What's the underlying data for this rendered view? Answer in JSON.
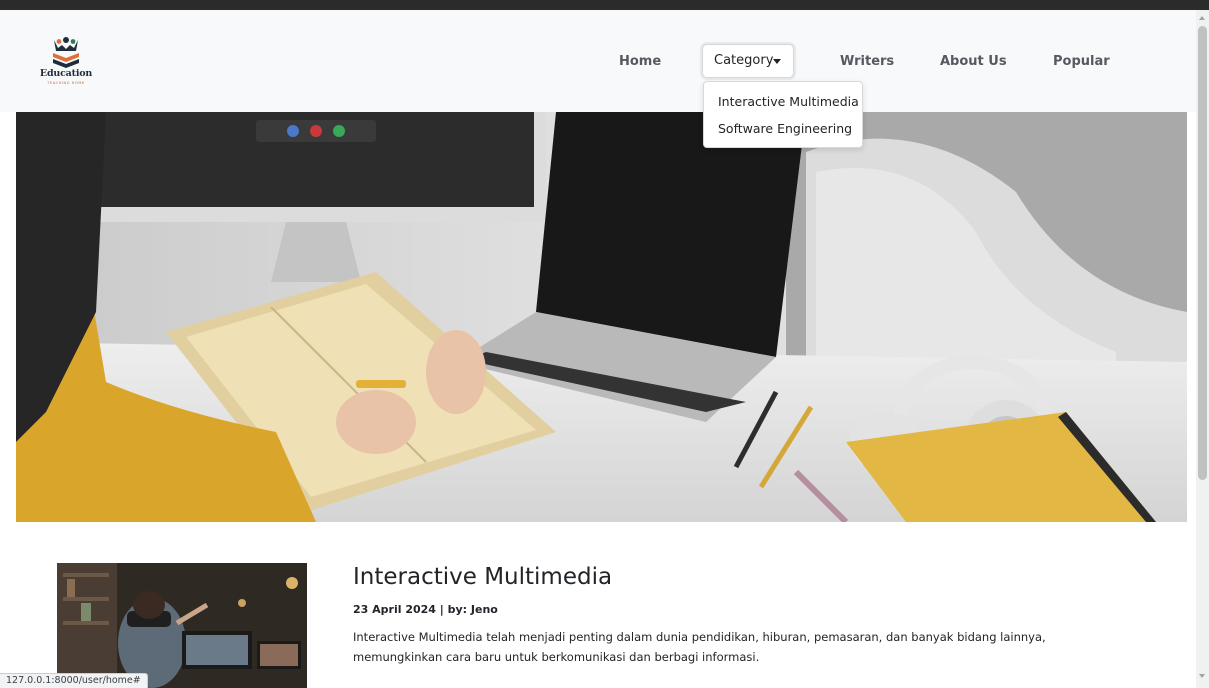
{
  "brand": {
    "name": "Education",
    "tagline": "TEACHING HOME",
    "colors": {
      "navy": "#1e2d3b",
      "orange": "#e0703a",
      "green": "#2e7d4f"
    }
  },
  "nav": {
    "home": "Home",
    "category": "Category",
    "writers": "Writers",
    "about": "About Us",
    "popular": "Popular"
  },
  "dropdown": {
    "items": [
      {
        "label": "Interactive Multimedia"
      },
      {
        "label": "Software Engineering"
      }
    ]
  },
  "article": {
    "title": "Interactive Multimedia",
    "meta": "23 April 2024 | by: Jeno",
    "excerpt": "Interactive Multimedia telah menjadi penting dalam dunia pendidikan, hiburan, pemasaran, dan banyak bidang lainnya, memungkinkan cara baru untuk berkomunikasi dan berbagi informasi."
  },
  "status": {
    "url": "127.0.0.1:8000/user/home#"
  }
}
